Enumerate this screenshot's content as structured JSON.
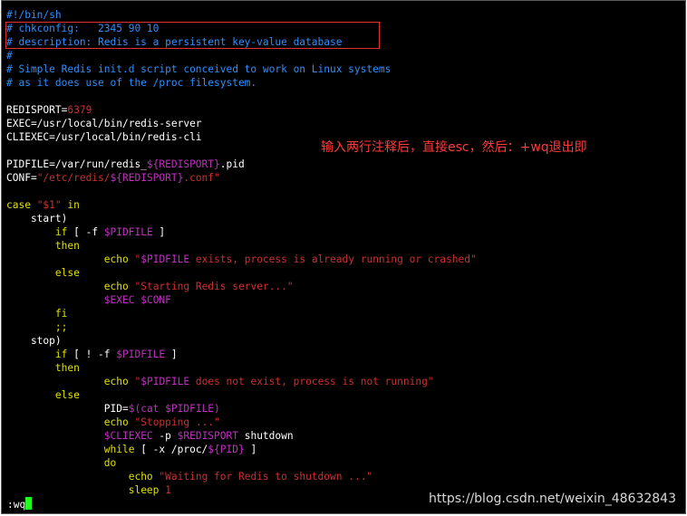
{
  "colors": {
    "background": "#000000",
    "text": "#ffffff",
    "comment": "#2f8fff",
    "string": "#cc3030",
    "variable": "#c030c0",
    "keyword": "#e0e000",
    "cursor": "#20ff20",
    "annotation": "#ff3a3a",
    "highlight_box": "#e03030",
    "watermark": "#d8d8d8"
  },
  "editor": {
    "lines": [
      [
        {
          "t": "#!/bin/sh",
          "c": "comment"
        }
      ],
      [
        {
          "t": "# chkconfig:   2345 90 10",
          "c": "comment"
        }
      ],
      [
        {
          "t": "# description: Redis is a persistent key-value database",
          "c": "comment"
        }
      ],
      [
        {
          "t": "#",
          "c": "comment"
        }
      ],
      [
        {
          "t": "# Simple Redis init.d script conceived to work on Linux systems",
          "c": "comment"
        }
      ],
      [
        {
          "t": "# as it does use of the /proc filesystem.",
          "c": "comment"
        }
      ],
      [],
      [
        {
          "t": "REDISPORT=",
          "c": "text"
        },
        {
          "t": "6379",
          "c": "string"
        }
      ],
      [
        {
          "t": "EXEC=/usr/local/bin/redis-server",
          "c": "text"
        }
      ],
      [
        {
          "t": "CLIEXEC=/usr/local/bin/redis-cli",
          "c": "text"
        }
      ],
      [],
      [
        {
          "t": "PIDFILE=/var/run/redis_",
          "c": "text"
        },
        {
          "t": "${REDISPORT}",
          "c": "variable"
        },
        {
          "t": ".pid",
          "c": "text"
        }
      ],
      [
        {
          "t": "CONF=",
          "c": "text"
        },
        {
          "t": "\"/etc/redis/",
          "c": "string"
        },
        {
          "t": "${REDISPORT}",
          "c": "variable"
        },
        {
          "t": ".conf\"",
          "c": "string"
        }
      ],
      [],
      [
        {
          "t": "case ",
          "c": "keyword"
        },
        {
          "t": "\"$1\"",
          "c": "string"
        },
        {
          "t": " in",
          "c": "keyword"
        }
      ],
      [
        {
          "t": "    start)",
          "c": "text"
        }
      ],
      [
        {
          "t": "        ",
          "c": "text"
        },
        {
          "t": "if",
          "c": "keyword"
        },
        {
          "t": " [ -f ",
          "c": "text"
        },
        {
          "t": "$PIDFILE",
          "c": "variable"
        },
        {
          "t": " ]",
          "c": "text"
        }
      ],
      [
        {
          "t": "        ",
          "c": "text"
        },
        {
          "t": "then",
          "c": "keyword"
        }
      ],
      [
        {
          "t": "                ",
          "c": "text"
        },
        {
          "t": "echo",
          "c": "keyword"
        },
        {
          "t": " ",
          "c": "text"
        },
        {
          "t": "\"",
          "c": "string"
        },
        {
          "t": "$PIDFILE",
          "c": "variable"
        },
        {
          "t": " exists, process is already running or crashed\"",
          "c": "string"
        }
      ],
      [
        {
          "t": "        ",
          "c": "text"
        },
        {
          "t": "else",
          "c": "keyword"
        }
      ],
      [
        {
          "t": "                ",
          "c": "text"
        },
        {
          "t": "echo",
          "c": "keyword"
        },
        {
          "t": " ",
          "c": "text"
        },
        {
          "t": "\"Starting Redis server...\"",
          "c": "string"
        }
      ],
      [
        {
          "t": "                ",
          "c": "text"
        },
        {
          "t": "$EXEC",
          "c": "variable"
        },
        {
          "t": " ",
          "c": "text"
        },
        {
          "t": "$CONF",
          "c": "variable"
        }
      ],
      [
        {
          "t": "        ",
          "c": "text"
        },
        {
          "t": "fi",
          "c": "keyword"
        }
      ],
      [
        {
          "t": "        ",
          "c": "text"
        },
        {
          "t": ";;",
          "c": "keyword"
        }
      ],
      [
        {
          "t": "    stop)",
          "c": "text"
        }
      ],
      [
        {
          "t": "        ",
          "c": "text"
        },
        {
          "t": "if",
          "c": "keyword"
        },
        {
          "t": " [ ! -f ",
          "c": "text"
        },
        {
          "t": "$PIDFILE",
          "c": "variable"
        },
        {
          "t": " ]",
          "c": "text"
        }
      ],
      [
        {
          "t": "        ",
          "c": "text"
        },
        {
          "t": "then",
          "c": "keyword"
        }
      ],
      [
        {
          "t": "                ",
          "c": "text"
        },
        {
          "t": "echo",
          "c": "keyword"
        },
        {
          "t": " ",
          "c": "text"
        },
        {
          "t": "\"",
          "c": "string"
        },
        {
          "t": "$PIDFILE",
          "c": "variable"
        },
        {
          "t": " does not exist, process is not running\"",
          "c": "string"
        }
      ],
      [
        {
          "t": "        ",
          "c": "text"
        },
        {
          "t": "else",
          "c": "keyword"
        }
      ],
      [
        {
          "t": "                ",
          "c": "text"
        },
        {
          "t": "PID=",
          "c": "text"
        },
        {
          "t": "$(cat ",
          "c": "variable"
        },
        {
          "t": "$PIDFILE",
          "c": "variable"
        },
        {
          "t": ")",
          "c": "variable"
        }
      ],
      [
        {
          "t": "                ",
          "c": "text"
        },
        {
          "t": "echo",
          "c": "keyword"
        },
        {
          "t": " ",
          "c": "text"
        },
        {
          "t": "\"Stopping ...\"",
          "c": "string"
        }
      ],
      [
        {
          "t": "                ",
          "c": "text"
        },
        {
          "t": "$CLIEXEC",
          "c": "variable"
        },
        {
          "t": " -p ",
          "c": "text"
        },
        {
          "t": "$REDISPORT",
          "c": "variable"
        },
        {
          "t": " shutdown",
          "c": "text"
        }
      ],
      [
        {
          "t": "                ",
          "c": "text"
        },
        {
          "t": "while",
          "c": "keyword"
        },
        {
          "t": " [ -x /proc/",
          "c": "text"
        },
        {
          "t": "${PID}",
          "c": "variable"
        },
        {
          "t": " ]",
          "c": "text"
        }
      ],
      [
        {
          "t": "                ",
          "c": "text"
        },
        {
          "t": "do",
          "c": "keyword"
        }
      ],
      [
        {
          "t": "                    ",
          "c": "text"
        },
        {
          "t": "echo",
          "c": "keyword"
        },
        {
          "t": " ",
          "c": "text"
        },
        {
          "t": "\"Waiting for Redis to shutdown ...\"",
          "c": "string"
        }
      ],
      [
        {
          "t": "                    ",
          "c": "text"
        },
        {
          "t": "sleep",
          "c": "keyword"
        },
        {
          "t": " ",
          "c": "text"
        },
        {
          "t": "1",
          "c": "string"
        }
      ]
    ],
    "command_line": ":wq"
  },
  "annotation": "输入两行注释后，直接esc，然后：+wq退出即",
  "watermark": "https://blog.csdn.net/weixin_48632843"
}
